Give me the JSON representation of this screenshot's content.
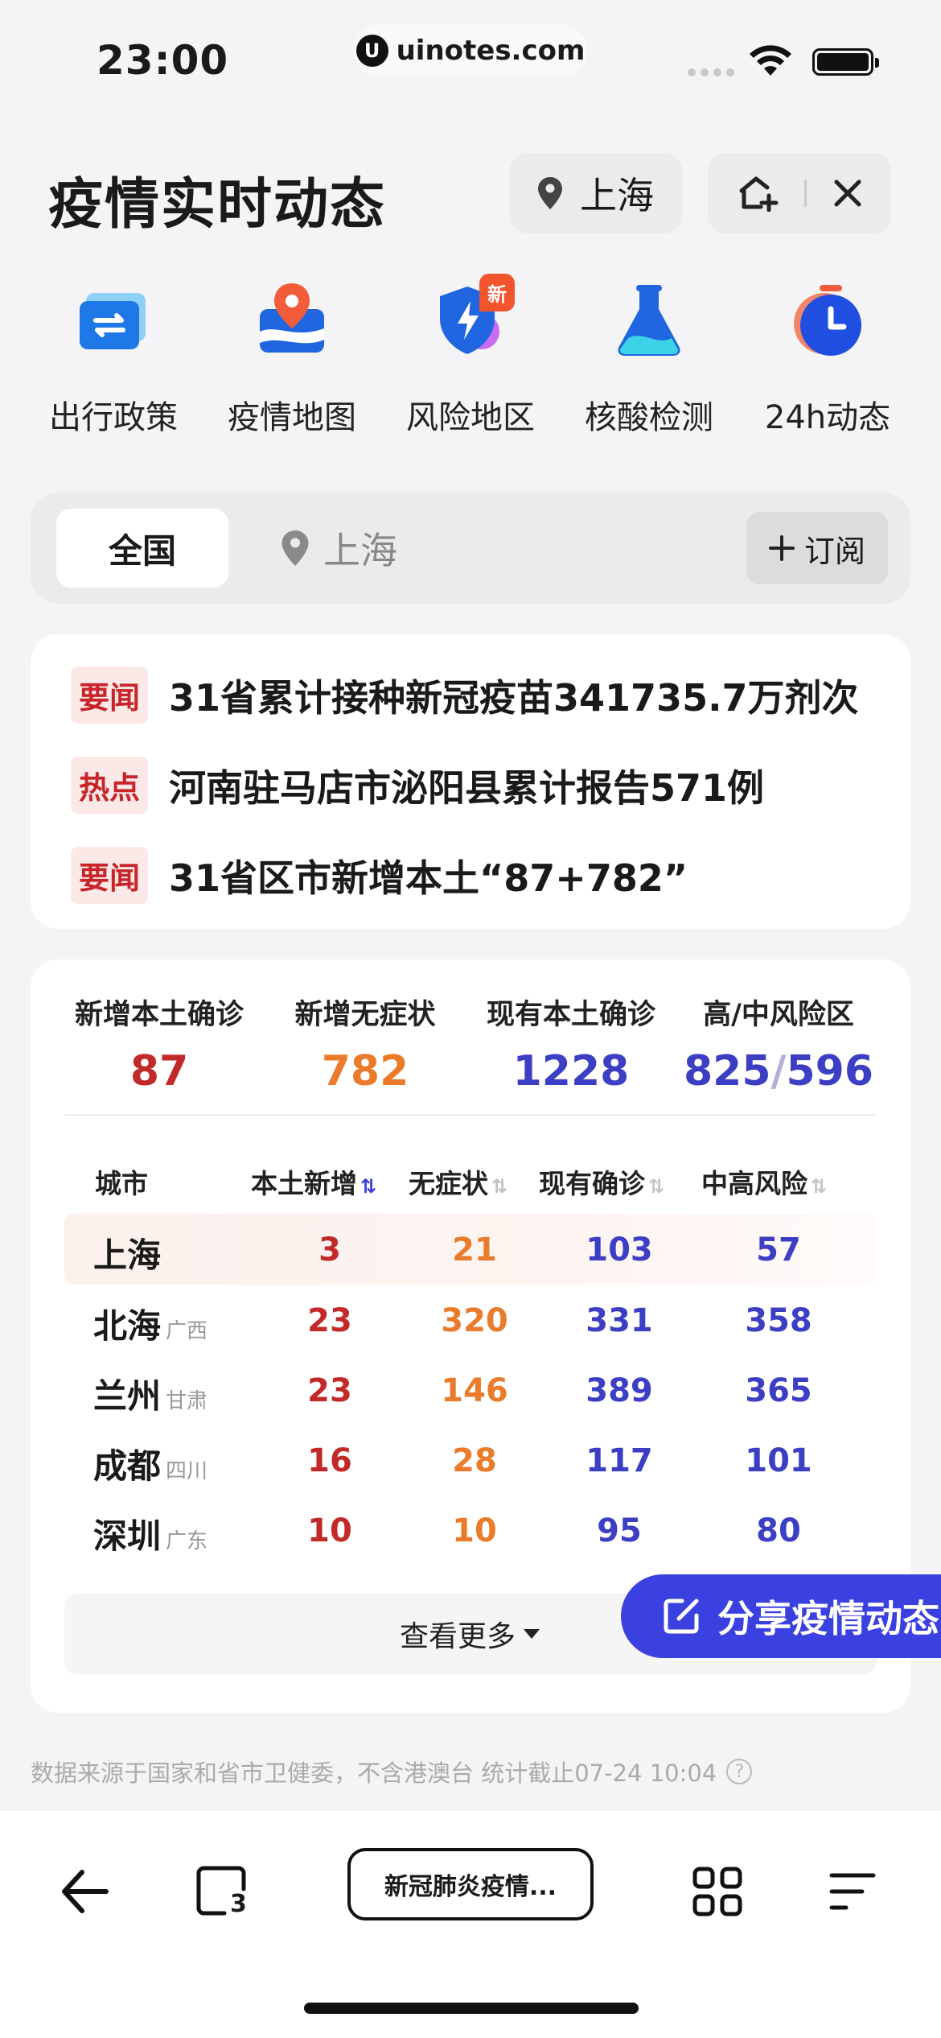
{
  "status_bar": {
    "time": "23:00",
    "url": "uinotes.com"
  },
  "header": {
    "title": "疫情实时动态",
    "location": "上海"
  },
  "quick_links": [
    {
      "label": "出行政策",
      "icon": "ticket-icon"
    },
    {
      "label": "疫情地图",
      "icon": "map-pin-icon"
    },
    {
      "label": "风险地区",
      "icon": "shield-bolt-icon",
      "badge": "新"
    },
    {
      "label": "核酸检测",
      "icon": "flask-icon"
    },
    {
      "label": "24h动态",
      "icon": "clock-icon"
    }
  ],
  "region_tabs": {
    "all": "全国",
    "city": "上海",
    "subscribe": "订阅"
  },
  "news": [
    {
      "tag": "要闻",
      "text": "31省累计接种新冠疫苗341735.7万剂次"
    },
    {
      "tag": "热点",
      "text": "河南驻马店市泌阳县累计报告571例"
    },
    {
      "tag": "要闻",
      "text": "31省区市新增本土“87+782”"
    }
  ],
  "stats": [
    {
      "label": "新增本土确诊",
      "value": "87",
      "color": "#c22a2a"
    },
    {
      "label": "新增无症状",
      "value": "782",
      "color": "#ea7b2a"
    },
    {
      "label": "现有本土确诊",
      "value": "1228",
      "color": "#3c3ec3"
    },
    {
      "label": "高/中风险区",
      "value_high": "825",
      "sep": "/",
      "value_mid": "596",
      "color": "#3c3ec3"
    }
  ],
  "table": {
    "headers": [
      "城市",
      "本土新增",
      "无症状",
      "现有确诊",
      "中高风险"
    ],
    "rows": [
      {
        "city": "上海",
        "province": "",
        "new": "3",
        "asym": "21",
        "current": "103",
        "risk": "57"
      },
      {
        "city": "北海",
        "province": "广西",
        "new": "23",
        "asym": "320",
        "current": "331",
        "risk": "358"
      },
      {
        "city": "兰州",
        "province": "甘肃",
        "new": "23",
        "asym": "146",
        "current": "389",
        "risk": "365"
      },
      {
        "city": "成都",
        "province": "四川",
        "new": "16",
        "asym": "28",
        "current": "117",
        "risk": "101"
      },
      {
        "city": "深圳",
        "province": "广东",
        "new": "10",
        "asym": "10",
        "current": "95",
        "risk": "80"
      }
    ],
    "more": "查看更多"
  },
  "share_label": "分享疫情动态",
  "footnote": "数据来源于国家和省市卫健委，不含港澳台 统计截止07-24 10:04",
  "bottom_nav": {
    "page_label": "新冠肺炎疫情...",
    "tab_count": "3"
  },
  "colors": {
    "accent": "#3b40e0",
    "red": "#c22a2a",
    "orange": "#ea7b2a",
    "blue": "#3c3ec3"
  }
}
